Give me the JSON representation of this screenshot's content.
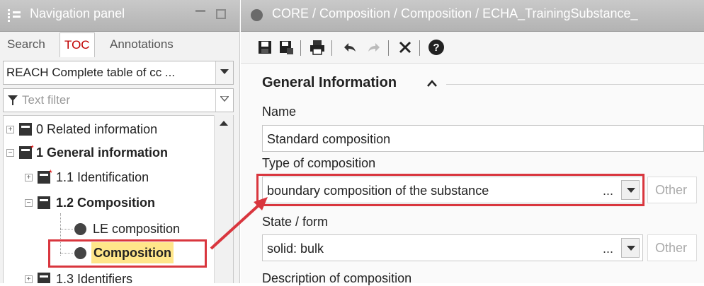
{
  "nav": {
    "title": "Navigation panel",
    "tabs": [
      "Search",
      "TOC",
      "Annotations"
    ],
    "toc_selector": "REACH Complete table of cc ...",
    "filter_placeholder": "Text filter",
    "tree": [
      {
        "label": "0 Related information",
        "level": 0,
        "icon": "document-icon",
        "bold": false
      },
      {
        "label": "1 General information",
        "level": 0,
        "icon": "document-flag-icon",
        "bold": true
      },
      {
        "label": "1.1 Identification",
        "level": 1,
        "icon": "document-flag-icon",
        "bold": false
      },
      {
        "label": "1.2 Composition",
        "level": 1,
        "icon": "document-icon",
        "bold": true
      },
      {
        "label": "LE composition",
        "level": 2,
        "icon": "dot-icon",
        "bold": false
      },
      {
        "label": "Composition",
        "level": 2,
        "icon": "dot-icon",
        "bold": true,
        "selected": true
      },
      {
        "label": "1.3 Identifiers",
        "level": 1,
        "icon": "document-icon",
        "bold": false
      }
    ]
  },
  "doc": {
    "title": "CORE / Composition / Composition / ECHA_TrainingSubstance_",
    "toolbar_icons": [
      "save-icon",
      "save-as-icon",
      "print-icon",
      "undo-icon",
      "redo-icon",
      "close-icon",
      "help-icon"
    ],
    "section_title": "General Information",
    "fields": {
      "name_label": "Name",
      "name_value": "Standard composition",
      "type_label": "Type of composition",
      "type_value": "boundary composition of the substance",
      "type_other": "Other",
      "state_label": "State / form",
      "state_value": "solid: bulk",
      "state_other": "Other",
      "desc_label": "Description of composition",
      "ellipsis": "..."
    }
  },
  "colors": {
    "highlight": "#d9363e",
    "toc_active": "#c00000",
    "selected_bg": "#ffe68a"
  }
}
